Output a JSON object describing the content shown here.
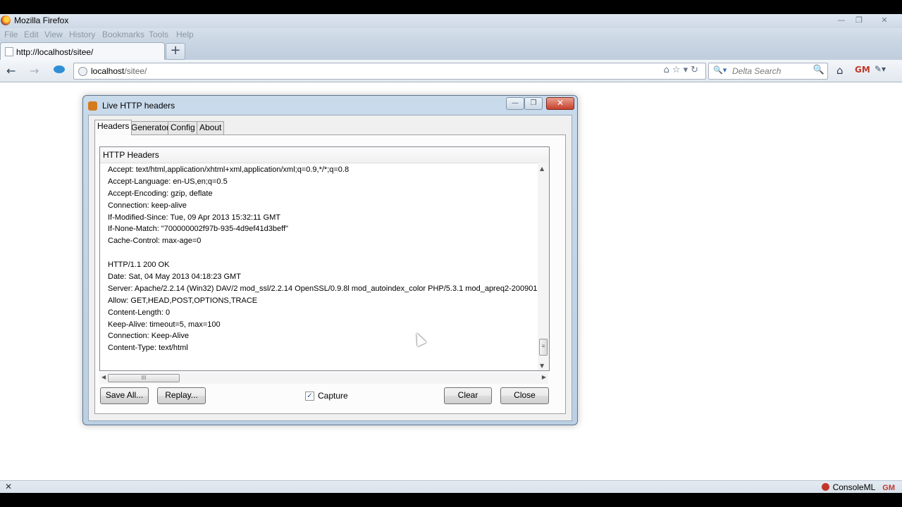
{
  "window": {
    "title": "Mozilla Firefox",
    "controls": {
      "minimize": "—",
      "restore": "❐",
      "close": "✕"
    }
  },
  "menu": [
    "File",
    "Edit",
    "View",
    "History",
    "Bookmarks",
    "Tools",
    "Help"
  ],
  "tab": {
    "title": "http://localhost/sitee/",
    "new_tab": "+"
  },
  "nav": {
    "back": "←",
    "forward": "→",
    "url_host": "localhost",
    "url_path": "/sitee/",
    "url_tools": "⌂☆▾↻",
    "search_engine": "🔍▾",
    "search_placeholder": "Delta Search",
    "search_go": "🔍",
    "home": "⌂",
    "gm": "GM",
    "puzzle": "✎▾"
  },
  "dialog": {
    "title": "Live HTTP headers",
    "controls": {
      "minimize": "—",
      "restore": "❐",
      "close": "✕"
    },
    "tabs": [
      "Headers",
      "Generator",
      "Config",
      "About"
    ],
    "list_header": "HTTP Headers",
    "lines": [
      "Accept: text/html,application/xhtml+xml,application/xml;q=0.9,*/*;q=0.8",
      "Accept-Language: en-US,en;q=0.5",
      "Accept-Encoding: gzip, deflate",
      "Connection: keep-alive",
      "If-Modified-Since: Tue, 09 Apr 2013 15:32:11 GMT",
      "If-None-Match: \"700000002f97b-935-4d9ef41d3beff\"",
      "Cache-Control: max-age=0",
      "",
      "HTTP/1.1 200 OK",
      "Date: Sat, 04 May 2013 04:18:23 GMT",
      "Server: Apache/2.2.14 (Win32) DAV/2 mod_ssl/2.2.14 OpenSSL/0.9.8l mod_autoindex_color PHP/5.3.1 mod_apreq2-200901...",
      "Allow: GET,HEAD,POST,OPTIONS,TRACE",
      "Content-Length: 0",
      "Keep-Alive: timeout=5, max=100",
      "Connection: Keep-Alive",
      "Content-Type: text/html"
    ],
    "buttons": {
      "save_all": "Save All...",
      "replay": "Replay...",
      "clear": "Clear",
      "close": "Close"
    },
    "capture": {
      "label": "Capture",
      "checked": true,
      "check_mark": "✓"
    },
    "scroll_glyphs": {
      "up": "▲",
      "down": "▼",
      "left": "◀",
      "right": "▶",
      "grip": "≡",
      "hgrip": "III"
    }
  },
  "statusbar": {
    "close": "✕",
    "right_label": "ConsoleML",
    "gm": "GM"
  }
}
